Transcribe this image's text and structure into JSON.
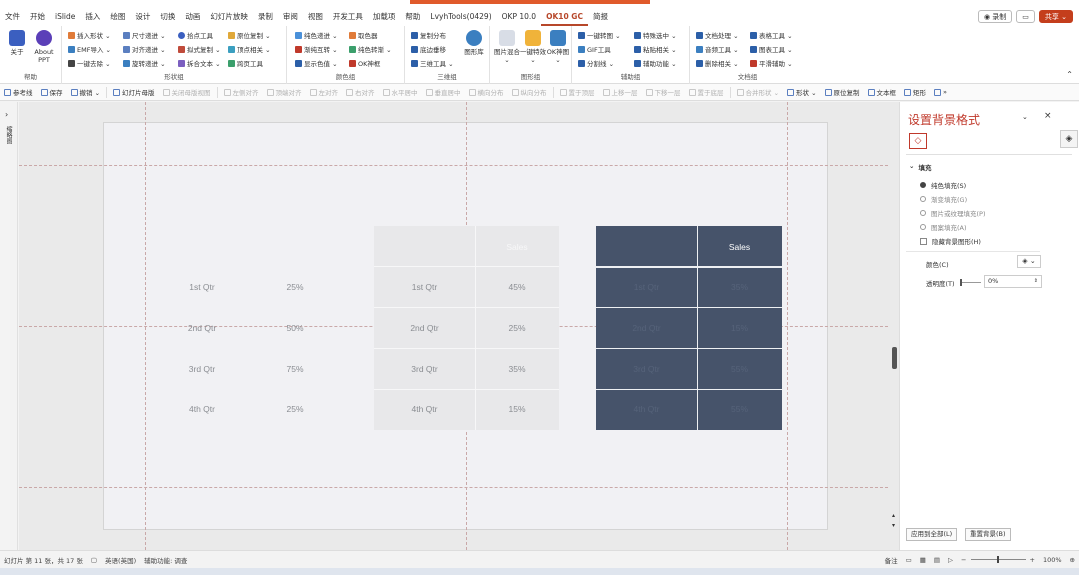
{
  "menu": {
    "items": [
      "文件",
      "开始",
      "iSlide",
      "插入",
      "绘图",
      "设计",
      "切换",
      "动画",
      "幻灯片放映",
      "录制",
      "审阅",
      "视图",
      "开发工具",
      "加载项",
      "帮助",
      "LvyhTools(0429)",
      "OKP 10.0",
      "OK10 GC",
      "简报"
    ],
    "active": "OK10 GC",
    "record": "◉ 录制",
    "comment_icon": "comment-icon",
    "share": "共享 ⌄"
  },
  "ribbon": {
    "group_help": {
      "label": "帮助",
      "about": "关于",
      "about_ppt": "About PPT"
    },
    "group_shape": {
      "label": "形状组",
      "items": [
        "插入形状 ⌄",
        "尺寸递进 ⌄",
        "拾点工具",
        "原位复制 ⌄",
        "EMF导入 ⌄",
        "对齐递进 ⌄",
        "拟式复制 ⌄",
        "顶点相关 ⌄",
        "一键去除 ⌄",
        "旋转递进 ⌄",
        "拆合文本 ⌄",
        "跨页工具"
      ]
    },
    "group_color": {
      "label": "颜色组",
      "items": [
        "纯色递进 ⌄",
        "取色器",
        "渐纯互转 ⌄",
        "纯色转渐 ⌄",
        "显示色值 ⌄",
        "OK神框"
      ]
    },
    "group_3d": {
      "label": "三维组",
      "items": [
        "复制分布",
        "底边垂移",
        "三维工具 ⌄"
      ],
      "big": "图形库"
    },
    "group_image": {
      "label": "图形组",
      "items": [
        "图片混合 ⌄",
        "一键特效 ⌄",
        "OK神图 ⌄"
      ]
    },
    "group_aux": {
      "label": "辅助组",
      "items": [
        "一键转图 ⌄",
        "特殊选中 ⌄",
        "GIF工具",
        "粘贴相关 ⌄",
        "分割线 ⌄",
        "辅助功能 ⌄"
      ]
    },
    "group_doc": {
      "label": "文档组",
      "items": [
        "文档处理 ⌄",
        "表格工具 ⌄",
        "音频工具 ⌄",
        "图表工具 ⌄",
        "删除相关 ⌄",
        "平滑辅助 ⌄"
      ]
    }
  },
  "qat": {
    "items": [
      {
        "label": "参考线",
        "dim": false
      },
      {
        "label": "保存",
        "dim": false
      },
      {
        "label": "撤销 ⌄",
        "dim": false
      },
      {
        "label": "幻灯片母版",
        "dim": false
      },
      {
        "label": "关闭母版视图",
        "dim": true
      },
      {
        "label": "左侧对齐",
        "dim": true
      },
      {
        "label": "顶端对齐",
        "dim": true
      },
      {
        "label": "左对齐",
        "dim": true
      },
      {
        "label": "右对齐",
        "dim": true
      },
      {
        "label": "水平居中",
        "dim": true
      },
      {
        "label": "垂直居中",
        "dim": true
      },
      {
        "label": "横向分布",
        "dim": true
      },
      {
        "label": "纵向分布",
        "dim": true
      },
      {
        "label": "置于顶层",
        "dim": true
      },
      {
        "label": "上移一层",
        "dim": true
      },
      {
        "label": "下移一层",
        "dim": true
      },
      {
        "label": "置于底层",
        "dim": true
      },
      {
        "label": "合并形状 ⌄",
        "dim": true
      },
      {
        "label": "形状 ⌄",
        "dim": false
      },
      {
        "label": "原位复制",
        "dim": false
      },
      {
        "label": "文本框",
        "dim": false
      },
      {
        "label": "矩形",
        "dim": false
      },
      {
        "label": "»",
        "dim": false
      }
    ]
  },
  "thumbnails_label": "缩略图",
  "slide": {
    "table1": {
      "rows": [
        {
          "label": "1st Qtr",
          "value": "25%"
        },
        {
          "label": "2nd Qtr",
          "value": "50%"
        },
        {
          "label": "3rd Qtr",
          "value": "75%"
        },
        {
          "label": "4th Qtr",
          "value": "25%"
        }
      ]
    },
    "table2": {
      "header": [
        "",
        "Sales"
      ],
      "rows": [
        {
          "label": "1st Qtr",
          "value": "45%"
        },
        {
          "label": "2nd Qtr",
          "value": "25%"
        },
        {
          "label": "3rd Qtr",
          "value": "35%"
        },
        {
          "label": "4th Qtr",
          "value": "15%"
        }
      ]
    },
    "table3": {
      "header": [
        "",
        "Sales"
      ],
      "rows": [
        {
          "label": "1st Qtr",
          "value": "35%"
        },
        {
          "label": "2nd Qtr",
          "value": "15%"
        },
        {
          "label": "3rd Qtr",
          "value": "55%"
        },
        {
          "label": "4th Qtr",
          "value": "55%"
        }
      ]
    },
    "colors": {
      "dark_table": "#46536a",
      "light_table": "#e8e8ea"
    }
  },
  "pane": {
    "title": "设置背景格式",
    "section": "填充",
    "options": [
      {
        "label": "纯色填充(S)",
        "type": "radio",
        "checked": true
      },
      {
        "label": "渐变填充(G)",
        "type": "radio",
        "checked": false
      },
      {
        "label": "图片或纹理填充(P)",
        "type": "radio",
        "checked": false
      },
      {
        "label": "图案填充(A)",
        "type": "radio",
        "checked": false
      },
      {
        "label": "隐藏背景图形(H)",
        "type": "checkbox",
        "checked": false
      }
    ],
    "color_label": "颜色(C)",
    "transparency_label": "透明度(T)",
    "transparency_value": "0%",
    "apply_all": "应用到全部(L)",
    "reset": "重置背景(B)"
  },
  "status": {
    "slide_info": "幻灯片 第 11 张，共 17 张",
    "language": "英语(英国)",
    "accessibility": "辅助功能: 调查",
    "notes": "备注",
    "zoom": "100%"
  }
}
